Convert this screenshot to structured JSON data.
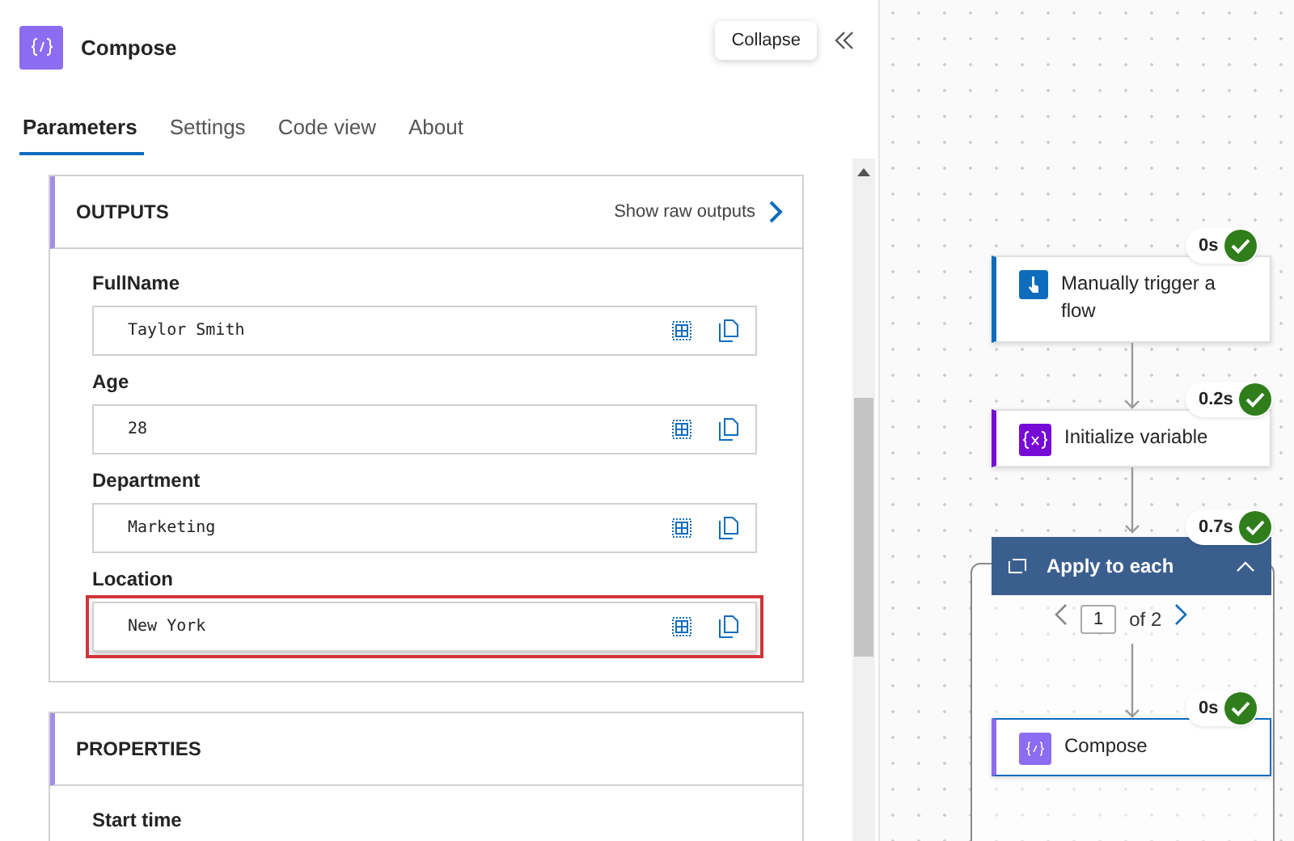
{
  "panel": {
    "title": "Compose",
    "collapse_tooltip": "Collapse",
    "tabs": [
      {
        "label": "Parameters",
        "selected": true
      },
      {
        "label": "Settings",
        "selected": false
      },
      {
        "label": "Code view",
        "selected": false
      },
      {
        "label": "About",
        "selected": false
      }
    ],
    "sections": [
      {
        "title": "OUTPUTS",
        "link": "Show raw outputs",
        "fields": [
          {
            "label": "FullName",
            "value": "Taylor Smith",
            "highlighted": false
          },
          {
            "label": "Age",
            "value": "28",
            "highlighted": false
          },
          {
            "label": "Department",
            "value": "Marketing",
            "highlighted": false
          },
          {
            "label": "Location",
            "value": "New York",
            "highlighted": true
          }
        ]
      },
      {
        "title": "PROPERTIES",
        "fields": [
          {
            "label": "Start time"
          }
        ]
      }
    ]
  },
  "flow": {
    "nodes": [
      {
        "kind": "trigger",
        "title": "Manually trigger a flow",
        "duration": "0s",
        "succeeded": true,
        "selected": false
      },
      {
        "kind": "variable",
        "title": "Initialize variable",
        "duration": "0.2s",
        "succeeded": true,
        "selected": false
      },
      {
        "kind": "loop",
        "title": "Apply to each",
        "duration": "0.7s",
        "succeeded": true,
        "selected": false,
        "page": "1",
        "page_total": "of 2",
        "children": [
          {
            "kind": "compose",
            "title": "Compose",
            "duration": "0s",
            "succeeded": true,
            "selected": true
          }
        ]
      }
    ]
  }
}
